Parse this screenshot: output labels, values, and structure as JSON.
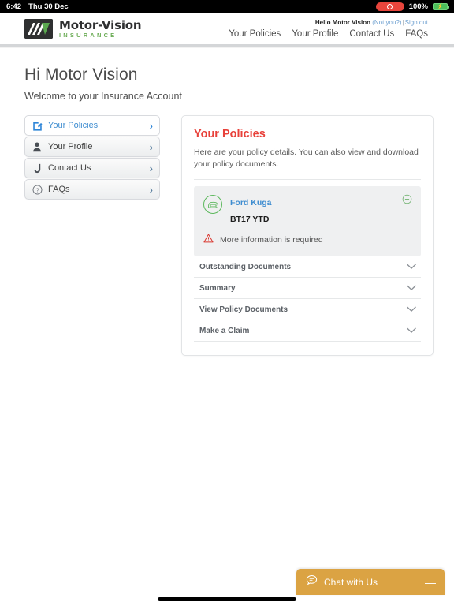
{
  "status_bar": {
    "time": "6:42",
    "date": "Thu 30 Dec",
    "battery_percent": "100%",
    "recording_icon": "record-indicator-icon",
    "battery_icon": "battery-charging-icon"
  },
  "header": {
    "logo": {
      "title": "Motor-Vision",
      "subtitle": "INSURANCE",
      "mark_icon": "mv-logo-icon"
    },
    "greeting": {
      "hello": "Hello Motor Vision",
      "not_you": "(Not you?)",
      "separator": "|",
      "sign_out": "Sign out"
    },
    "nav": [
      {
        "label": "Your Policies"
      },
      {
        "label": "Your Profile"
      },
      {
        "label": "Contact Us"
      },
      {
        "label": "FAQs"
      }
    ]
  },
  "page": {
    "title": "Hi Motor Vision",
    "subtitle": "Welcome to your Insurance Account"
  },
  "sidebar": {
    "items": [
      {
        "label": "Your Policies",
        "icon": "edit-document-icon",
        "active": true
      },
      {
        "label": "Your Profile",
        "icon": "user-icon",
        "active": false
      },
      {
        "label": "Contact Us",
        "icon": "phone-icon",
        "active": false
      },
      {
        "label": "FAQs",
        "icon": "question-circle-icon",
        "active": false
      }
    ],
    "chevron_icon": "chevron-right-icon"
  },
  "panel": {
    "title": "Your Policies",
    "description": "Here are your policy details. You can also view and download your policy documents."
  },
  "policy": {
    "vehicle_name": "Ford Kuga",
    "registration": "BT17 YTD",
    "vehicle_icon": "car-icon",
    "collapse_icon": "minus-circle-icon",
    "warning_icon": "warning-triangle-icon",
    "warning_text": "More information is required"
  },
  "accordion": {
    "chevron_icon": "chevron-down-icon",
    "rows": [
      {
        "label": "Outstanding Documents"
      },
      {
        "label": "Summary"
      },
      {
        "label": "View Policy Documents"
      },
      {
        "label": "Make a Claim"
      }
    ]
  },
  "chat": {
    "label": "Chat with Us",
    "icon": "chat-bubble-icon",
    "minimize_label": "—"
  },
  "colors": {
    "brand_red": "#e8413a",
    "brand_green": "#6aab54",
    "link_blue": "#3f8dd0",
    "chat_amber": "#dba343",
    "warning_red": "#d9332b"
  }
}
